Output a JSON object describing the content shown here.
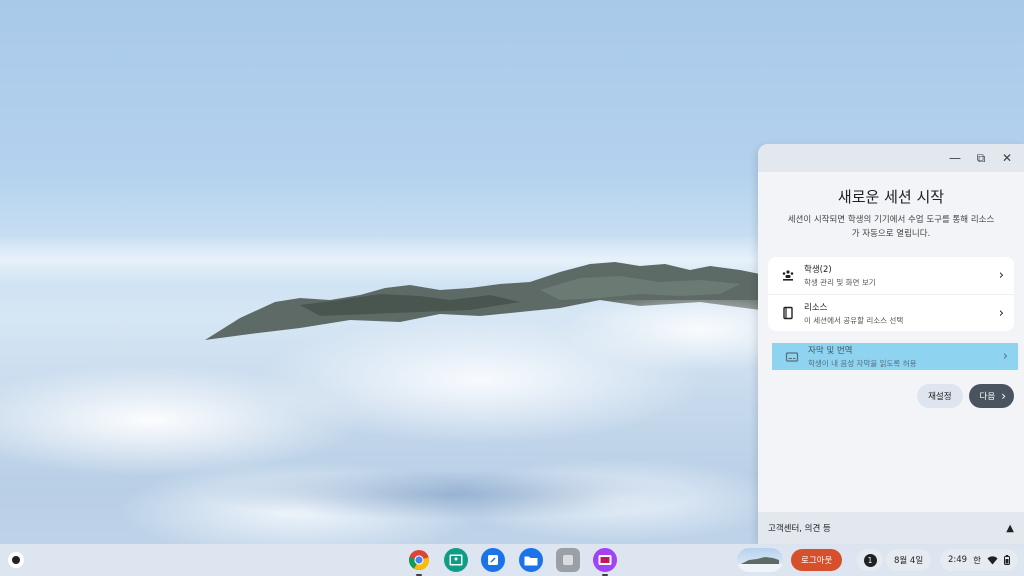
{
  "panel": {
    "title": "새로운 세션 시작",
    "subtitle": "세션이 시작되면 학생의 기기에서 수업 도구를 통해 리소스가 자동으로 열립니다.",
    "window_controls": {
      "minimize": "—",
      "restore": "⧉",
      "close": "✕"
    },
    "items": [
      {
        "title": "학생(2)",
        "description": "학생 관리 및 화면 보기",
        "icon": "students-icon"
      },
      {
        "title": "리소스",
        "description": "이 세션에서 공유할 리소스 선택",
        "icon": "book-icon"
      }
    ],
    "captions": {
      "title": "자막 및 번역",
      "description": "학생이 내 음성 자막을 읽도록 허용",
      "icon": "captions-icon"
    },
    "reset_label": "재설정",
    "next_label": "다음",
    "footer_label": "고객센터, 의견 등"
  },
  "shelf": {
    "apps": [
      {
        "name": "chrome",
        "icon": "chrome-icon",
        "active": true
      },
      {
        "name": "classroom",
        "icon": "classroom-icon",
        "active": false
      },
      {
        "name": "docs-app",
        "icon": "edit-app-icon",
        "active": false
      },
      {
        "name": "files",
        "icon": "files-icon",
        "active": false
      },
      {
        "name": "gray-app",
        "icon": "app-icon",
        "active": false
      },
      {
        "name": "class-tools",
        "icon": "class-tools-icon",
        "active": true
      }
    ],
    "logout_label": "로그아웃",
    "notification_count": "1",
    "date": "8월 4일",
    "time": "2:49",
    "ime": "한"
  },
  "colors": {
    "accent_dark": "#4a5360",
    "logout": "#d6502b",
    "caption_highlight": "#8ed4f0",
    "panel_bg": "#f3f4f7"
  }
}
